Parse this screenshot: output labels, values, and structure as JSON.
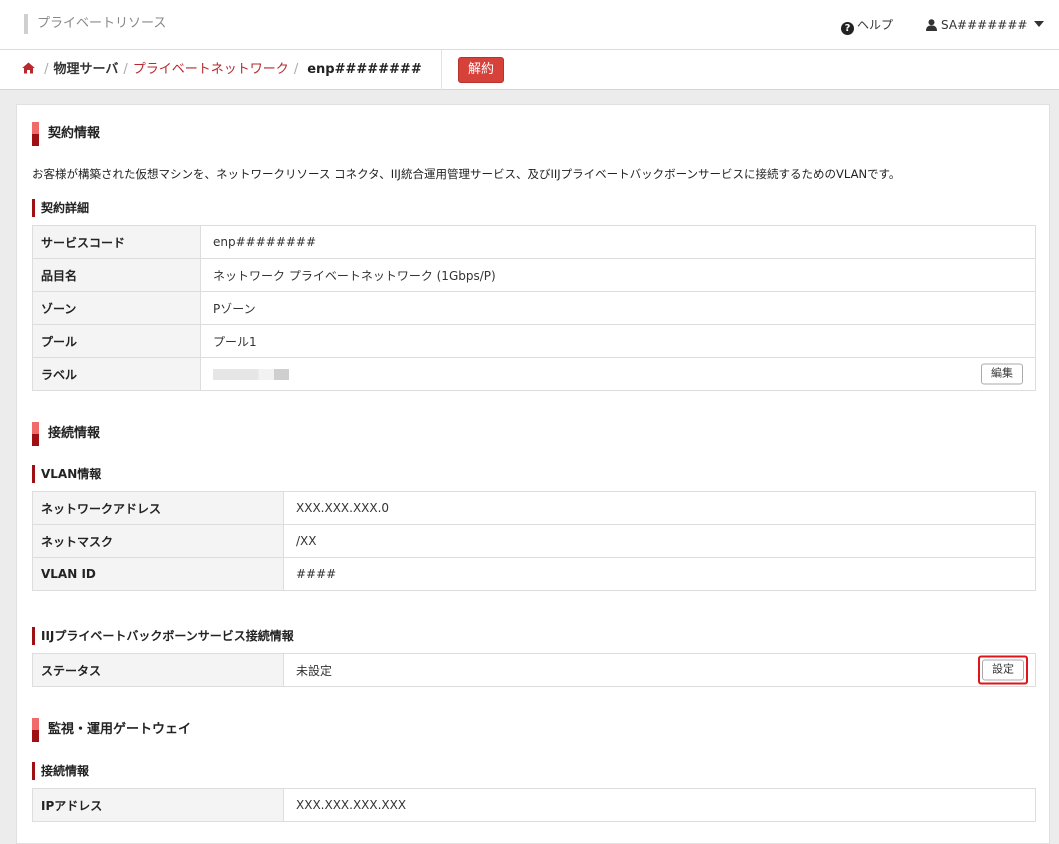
{
  "app": {
    "title": "プライベートリソース"
  },
  "header": {
    "help_label": "ヘルプ",
    "user_name": "SA#######"
  },
  "breadcrumb": {
    "items": [
      "物理サーバ",
      "プライベートネットワーク"
    ],
    "current": "enp########"
  },
  "actions": {
    "cancel_label": "解約"
  },
  "contract": {
    "title": "契約情報",
    "description": "お客様が構築された仮想マシンを、ネットワークリソース コネクタ、IIJ統合運用管理サービス、及びIIJプライベートバックボーンサービスに接続するためのVLANです。",
    "details_title": "契約詳細",
    "rows": [
      {
        "label": "サービスコード",
        "value": "enp########"
      },
      {
        "label": "品目名",
        "value": "ネットワーク プライベートネットワーク (1Gbps/P)"
      },
      {
        "label": "ゾーン",
        "value": "Pゾーン"
      },
      {
        "label": "プール",
        "value": "プール1"
      },
      {
        "label": "ラベル",
        "value": ""
      }
    ],
    "edit_label": "編集"
  },
  "connection": {
    "title": "接続情報",
    "vlan_title": "VLAN情報",
    "vlan_rows": [
      {
        "label": "ネットワークアドレス",
        "value": "XXX.XXX.XXX.0"
      },
      {
        "label": "ネットマスク",
        "value": "/XX"
      },
      {
        "label": "VLAN ID",
        "value": "####"
      }
    ],
    "backbone_title": "IIJプライベートバックボーンサービス接続情報",
    "backbone_rows": [
      {
        "label": "ステータス",
        "value": "未設定"
      }
    ],
    "setting_label": "設定"
  },
  "gateway": {
    "title": "監視・運用ゲートウェイ",
    "sub_title": "接続情報",
    "rows": [
      {
        "label": "IPアドレス",
        "value": "XXX.XXX.XXX.XXX"
      }
    ]
  },
  "colors": {
    "accent": "#b7292e",
    "danger_button": "#d6413a",
    "highlight": "#e0141b"
  }
}
